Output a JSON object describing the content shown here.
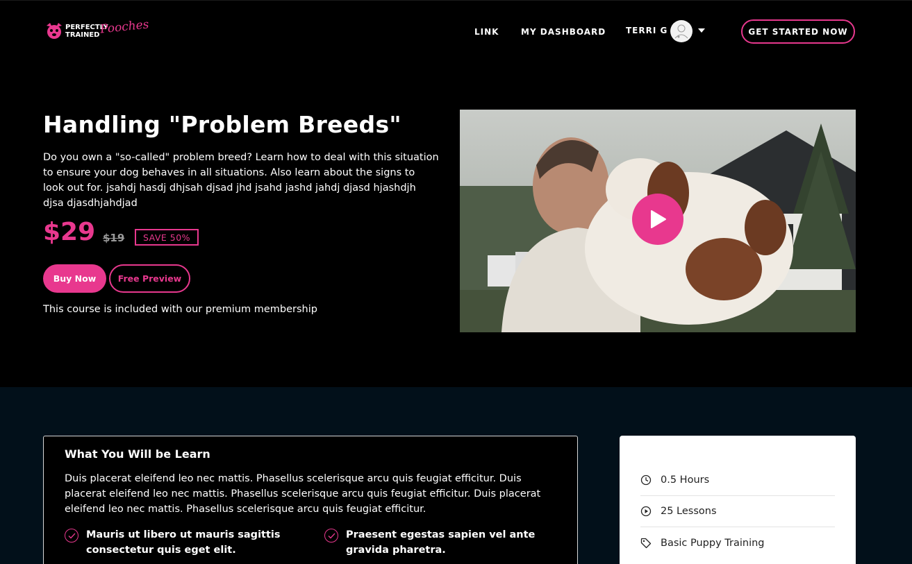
{
  "header": {
    "logo": {
      "line1": "PERFECTLY",
      "line2": "TRAINED",
      "script": "Pooches"
    },
    "nav": {
      "link_label": "LINK",
      "dashboard_label": "MY DASHBOARD",
      "user_name": "TERRI G"
    },
    "cta_label": "GET STARTED NOW"
  },
  "hero": {
    "title": "Handling \"Problem Breeds\"",
    "description": "Do you own a \"so-called\" problem breed? Learn how to deal with this situation to ensure your dog behaves in all situations. Also learn about the signs to look out for. jsahdj hasdj dhjsah djsad jhd jsahd jashd jahdj djasd hjashdjh djsa djasdhjahdjad",
    "price": "$29",
    "old_price": "$19",
    "save_badge": "SAVE 50%",
    "buy_label": "Buy Now",
    "preview_label": "Free Preview",
    "membership_note": "This course is included with our premium membership"
  },
  "learn": {
    "title": "What You Will be Learn",
    "description": "Duis placerat eleifend leo nec mattis. Phasellus scelerisque arcu quis feugiat efficitur. Duis placerat eleifend leo nec mattis. Phasellus scelerisque arcu quis feugiat efficitur. Duis placerat eleifend leo nec mattis. Phasellus scelerisque arcu quis feugiat efficitur.",
    "items": [
      "Mauris ut libero ut mauris sagittis consectetur quis eget elit.",
      "Praesent egestas sapien vel ante gravida pharetra."
    ]
  },
  "info": {
    "duration": "0.5 Hours",
    "lessons": "25 Lessons",
    "category": "Basic Puppy Training"
  },
  "colors": {
    "accent": "#e8388e",
    "background": "#000000",
    "section_bg": "#02101a"
  }
}
